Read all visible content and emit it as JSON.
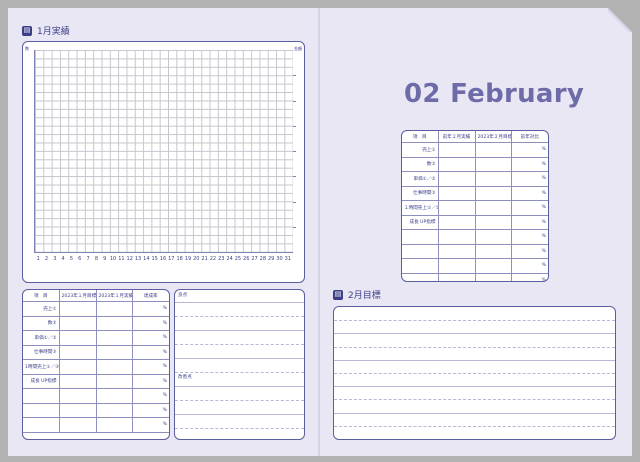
{
  "left": {
    "heading": {
      "icon": "document-chart-icon",
      "title": "1月実績"
    },
    "chart": {
      "y_top_label": "数",
      "right_top_label": "金額",
      "x_labels": [
        "1",
        "2",
        "3",
        "4",
        "5",
        "6",
        "7",
        "8",
        "9",
        "10",
        "11",
        "12",
        "13",
        "14",
        "15",
        "16",
        "17",
        "18",
        "19",
        "20",
        "21",
        "22",
        "23",
        "24",
        "25",
        "26",
        "27",
        "28",
        "29",
        "30",
        "31"
      ]
    },
    "table": {
      "headers": [
        "項　目",
        "2023年１月目標",
        "2023年１月実績",
        "達成率"
      ],
      "rows": [
        {
          "label": "売上①",
          "pct": "%"
        },
        {
          "label": "数②",
          "pct": "%"
        },
        {
          "label": "単価①／②",
          "pct": "%"
        },
        {
          "label": "仕事時間③",
          "pct": "%"
        },
        {
          "label": "1時間売上①／③",
          "pct": "%"
        },
        {
          "label": "成長 UP指標",
          "pct": "%"
        },
        {
          "label": "",
          "pct": "%"
        },
        {
          "label": "",
          "pct": "%"
        },
        {
          "label": "",
          "pct": "%"
        }
      ]
    },
    "memo": {
      "good_label": "良点",
      "improve_label": "改善点"
    }
  },
  "right": {
    "title": "02  February",
    "table": {
      "headers": [
        "項　目",
        "前年２月実績",
        "2023年２月目標",
        "前年対比"
      ],
      "rows": [
        {
          "label": "売上①",
          "pct": "%"
        },
        {
          "label": "数②",
          "pct": "%"
        },
        {
          "label": "単価①／②",
          "pct": "%"
        },
        {
          "label": "仕事時間③",
          "pct": "%"
        },
        {
          "label": "１時間売上①／③",
          "pct": "%"
        },
        {
          "label": "成長 UP指標",
          "pct": "%"
        },
        {
          "label": "",
          "pct": "%"
        },
        {
          "label": "",
          "pct": "%"
        },
        {
          "label": "",
          "pct": "%"
        },
        {
          "label": "",
          "pct": "%"
        }
      ]
    },
    "goal_heading": {
      "icon": "document-chart-icon",
      "title": "2月目標"
    }
  }
}
